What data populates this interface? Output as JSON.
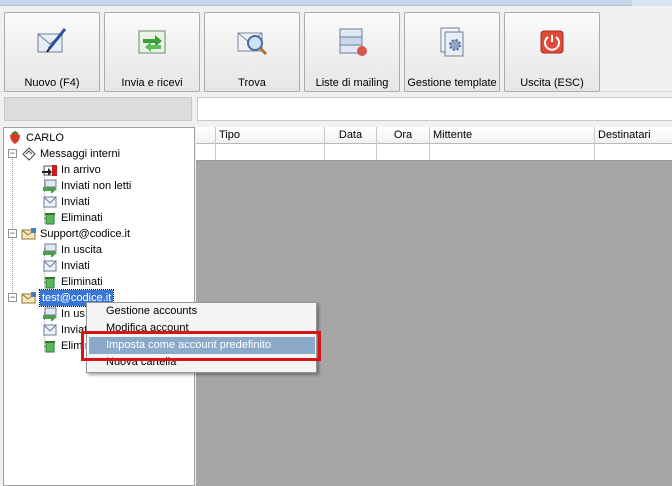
{
  "toolbar": {
    "buttons": [
      {
        "label": "Nuovo (F4)",
        "icon": "pen-envelope-icon"
      },
      {
        "label": "Invia e ricevi",
        "icon": "send-receive-icon"
      },
      {
        "label": "Trova",
        "icon": "magnifier-envelope-icon"
      },
      {
        "label": "Liste di mailing",
        "icon": "mailing-list-icon"
      },
      {
        "label": "Gestione template",
        "icon": "template-gear-icon"
      },
      {
        "label": "Uscita (ESC)",
        "icon": "power-icon"
      }
    ]
  },
  "tree": {
    "root": "CARLO",
    "groups": [
      {
        "label": "Messaggi interni",
        "expanded": true,
        "items": [
          "In arrivo",
          "Inviati non letti",
          "Inviati",
          "Eliminati"
        ]
      },
      {
        "label": "Support@codice.it",
        "expanded": true,
        "items": [
          "In uscita",
          "Inviati",
          "Eliminati"
        ]
      },
      {
        "label": "test@codice.it",
        "expanded": true,
        "selected": true,
        "items": [
          "In us",
          "Inviat",
          "Elimin"
        ]
      }
    ]
  },
  "grid": {
    "columns": [
      "",
      "Tipo",
      "Data",
      "Ora",
      "Mittente",
      "Destinatari"
    ]
  },
  "context_menu": {
    "items": [
      "Gestione accounts",
      "Modifica account",
      "Imposta come account predefinito",
      "Nuova cartella"
    ],
    "highlighted_index": 2
  },
  "colors": {
    "highlight": "#8ba9c9",
    "annotation_box": "#d81515",
    "grid_background": "#a6a6a6"
  }
}
